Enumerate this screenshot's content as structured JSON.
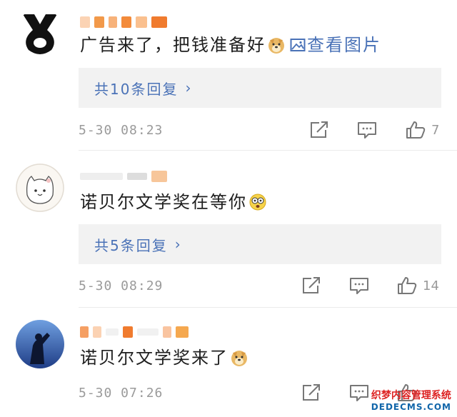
{
  "comments": [
    {
      "text": "广告来了，把钱准备好",
      "view_pic": "查看图片",
      "reply_link": "共10条回复",
      "timestamp": "5-30 08:23",
      "likes": "7"
    },
    {
      "text": "诺贝尔文学奖在等你",
      "reply_link": "共5条回复",
      "timestamp": "5-30 08:29",
      "likes": "14"
    },
    {
      "text": "诺贝尔文学奖来了",
      "timestamp": "5-30 07:26",
      "likes": ""
    }
  ],
  "watermark": {
    "line1": "织梦内容管理系统",
    "line2": "DEDECMS.COM"
  },
  "colors": {
    "link": "#4a72b7",
    "meta": "#9a9a9a",
    "reply_bg": "#f2f2f2"
  }
}
